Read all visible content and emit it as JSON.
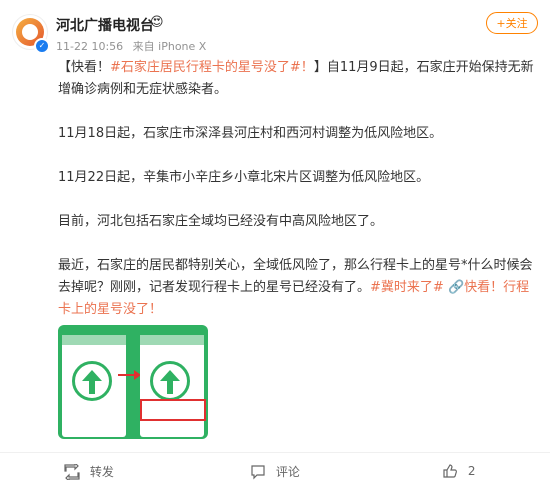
{
  "post": {
    "author": "河北广播电视台",
    "author_badge": "😍",
    "timestamp": "11-22 10:56",
    "source": "来自 iPhone X",
    "follow_label": "+关注",
    "verified_mark": "✓"
  },
  "content": {
    "p1_a": "【快看！",
    "p1_topic": "#石家庄居民行程卡的星号没了#！",
    "p1_b": "】自11月9日起，石家庄开始保持无新增确诊病例和无症状感染者。",
    "p2": "11月18日起，石家庄市深泽县河庄村和西河村调整为低风险地区。",
    "p3": "11月22日起，辛集市小辛庄乡小章北宋片区调整为低风险地区。",
    "p4": "目前，河北包括石家庄全域均已经没有中高风险地区了。",
    "p5_a": "最近，石家庄的居民都特别关心，全域低风险了，那么行程卡上的星号*什么时候会去掉呢？刚刚，记者发现行程卡上的星号已经没有了。",
    "p5_topic": "#冀时来了#",
    "p5_link_icon": "🔗",
    "p5_link": "快看！行程卡上的星号没了！"
  },
  "actions": {
    "repost": "转发",
    "comment": "评论",
    "like_count": "2"
  }
}
